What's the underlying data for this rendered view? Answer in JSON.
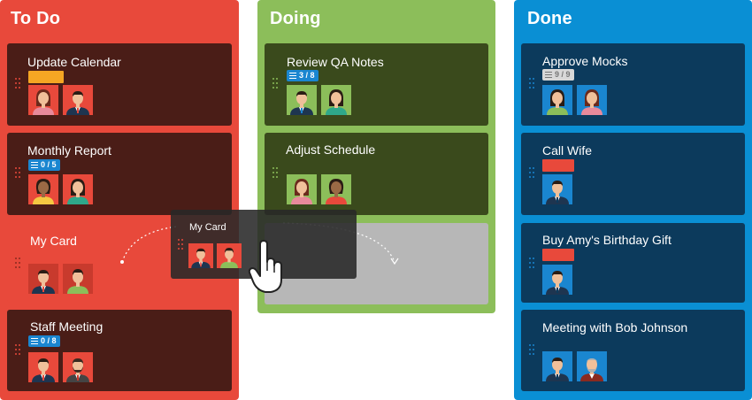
{
  "columns": [
    {
      "title": "To Do",
      "color": "#e8493b"
    },
    {
      "title": "Doing",
      "color": "#8cbe5a"
    },
    {
      "title": "Done",
      "color": "#0a8fd4"
    }
  ],
  "cards": {
    "update_calendar": {
      "title": "Update Calendar",
      "label_color": "#f5a623"
    },
    "monthly_report": {
      "title": "Monthly Report",
      "checklist": "0 / 5"
    },
    "my_card": {
      "title": "My Card"
    },
    "staff_meeting": {
      "title": "Staff Meeting",
      "checklist": "0 / 8"
    },
    "review_qa_notes": {
      "title": "Review QA Notes",
      "checklist": "3 / 8"
    },
    "adjust_schedule": {
      "title": "Adjust Schedule"
    },
    "approve_mocks": {
      "title": "Approve Mocks",
      "checklist": "9 / 9"
    },
    "call_wife": {
      "title": "Call Wife",
      "label_color": "#e8493b"
    },
    "buy_gift": {
      "title": "Buy Amy's Birthday Gift",
      "label_color": "#e8493b"
    },
    "meeting_bob": {
      "title": "Meeting with Bob Johnson"
    }
  },
  "drag": {
    "ghost_title": "My Card"
  },
  "colors": {
    "todo_card": "#4a1d17",
    "doing_card": "#3a4a1c",
    "done_card": "#0c3a5c",
    "badge_blue": "#1a86d0",
    "badge_grey": "#d8d8d8"
  },
  "icons": [
    "drag-handle-icon",
    "checklist-icon",
    "hand-cursor-icon",
    "person-avatar"
  ]
}
